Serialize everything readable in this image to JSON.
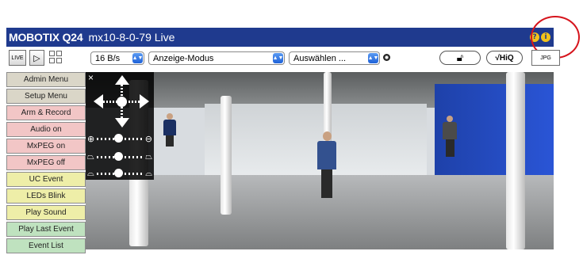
{
  "window": {
    "brand": "MOBOTIX Q24",
    "camera": "mx10-8-0-79 Live"
  },
  "title_icons": {
    "help": "?",
    "info": "i"
  },
  "toolbar": {
    "live_label": "LIVE",
    "play_label": "▷",
    "rate_select": "16 B/s",
    "mode_select": "Anzeige-Modus",
    "choose_select": "Auswählen ...",
    "hiq_label": "√HiQ",
    "jpg_label": "JPG"
  },
  "sidebar": {
    "items": [
      {
        "label": "Admin Menu",
        "color": "#dad6c8"
      },
      {
        "label": "Setup Menu",
        "color": "#dad6c8"
      },
      {
        "label": "Arm & Record",
        "color": "#f2c6c6"
      },
      {
        "label": "Audio on",
        "color": "#f2c6c6"
      },
      {
        "label": "MxPEG on",
        "color": "#f2c6c6"
      },
      {
        "label": "MxPEG off",
        "color": "#f2c6c6"
      },
      {
        "label": "UC Event",
        "color": "#eeeea8"
      },
      {
        "label": "LEDs Blink",
        "color": "#eeeea8"
      },
      {
        "label": "Play Sound",
        "color": "#eeeea8"
      },
      {
        "label": "Play Last Event",
        "color": "#bfe2bf"
      },
      {
        "label": "Event List",
        "color": "#bfe2bf"
      }
    ]
  },
  "ptz": {
    "close": "×"
  },
  "colors": {
    "titlebar": "#1f3a8e",
    "highlight_ring": "#d6141c"
  }
}
